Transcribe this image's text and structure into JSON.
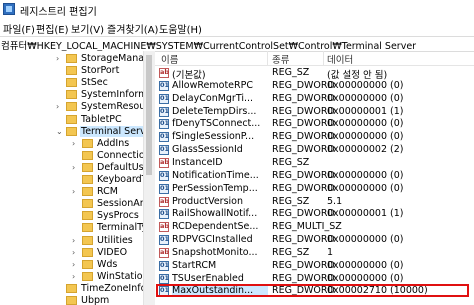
{
  "window": {
    "title": "레지스트리 편집기"
  },
  "menu": [
    "파일(F)",
    "편집(E)",
    "보기(V)",
    "즐겨찾기(A)",
    "도움말(H)"
  ],
  "address": "컴퓨터₩HKEY_LOCAL_MACHINE₩SYSTEM₩CurrentControlSet₩Control₩Terminal Server",
  "tree": [
    {
      "label": "StorageManage",
      "level": 0,
      "chevron": "›"
    },
    {
      "label": "StorPort",
      "level": 0,
      "chevron": ""
    },
    {
      "label": "StSec",
      "level": 0,
      "chevron": ""
    },
    {
      "label": "SystemInformat",
      "level": 0,
      "chevron": ""
    },
    {
      "label": "SystemResource",
      "level": 0,
      "chevron": "›"
    },
    {
      "label": "TabletPC",
      "level": 0,
      "chevron": ""
    },
    {
      "label": "Terminal Server",
      "level": 0,
      "chevron": "⌄",
      "selected": true
    },
    {
      "label": "AddIns",
      "level": 1,
      "chevron": "›"
    },
    {
      "label": "ConnectionH",
      "level": 1,
      "chevron": ""
    },
    {
      "label": "DefaultUserC",
      "level": 1,
      "chevron": "›"
    },
    {
      "label": "KeyboardTyp",
      "level": 1,
      "chevron": ""
    },
    {
      "label": "RCM",
      "level": 1,
      "chevron": "›"
    },
    {
      "label": "SessionArbit",
      "level": 1,
      "chevron": ""
    },
    {
      "label": "SysProcs",
      "level": 1,
      "chevron": ""
    },
    {
      "label": "TerminalTyp",
      "level": 1,
      "chevron": ""
    },
    {
      "label": "Utilities",
      "level": 1,
      "chevron": "›"
    },
    {
      "label": "VIDEO",
      "level": 1,
      "chevron": "›"
    },
    {
      "label": "Wds",
      "level": 1,
      "chevron": "›"
    },
    {
      "label": "WinStations",
      "level": 1,
      "chevron": "›"
    },
    {
      "label": "TimeZoneInfor",
      "level": 0,
      "chevron": ""
    },
    {
      "label": "Ubpm",
      "level": 0,
      "chevron": ""
    }
  ],
  "columns": {
    "name": "이름",
    "type": "종류",
    "data": "데이터"
  },
  "values": [
    {
      "name": "(기본값)",
      "type": "REG_SZ",
      "data": "(값 설정 안 됨)",
      "icon": "sz"
    },
    {
      "name": "AllowRemoteRPC",
      "type": "REG_DWORD",
      "data": "0x00000000 (0)",
      "icon": "dw"
    },
    {
      "name": "DelayConMgrTi...",
      "type": "REG_DWORD",
      "data": "0x00000000 (0)",
      "icon": "dw"
    },
    {
      "name": "DeleteTempDirs...",
      "type": "REG_DWORD",
      "data": "0x00000001 (1)",
      "icon": "dw"
    },
    {
      "name": "fDenyTSConnect...",
      "type": "REG_DWORD",
      "data": "0x00000000 (0)",
      "icon": "dw"
    },
    {
      "name": "fSingleSessionP...",
      "type": "REG_DWORD",
      "data": "0x00000000 (0)",
      "icon": "dw"
    },
    {
      "name": "GlassSessionId",
      "type": "REG_DWORD",
      "data": "0x00000002 (2)",
      "icon": "dw"
    },
    {
      "name": "InstanceID",
      "type": "REG_SZ",
      "data": "",
      "icon": "sz"
    },
    {
      "name": "NotificationTime...",
      "type": "REG_DWORD",
      "data": "0x00000000 (0)",
      "icon": "dw"
    },
    {
      "name": "PerSessionTemp...",
      "type": "REG_DWORD",
      "data": "0x00000000 (0)",
      "icon": "dw"
    },
    {
      "name": "ProductVersion",
      "type": "REG_SZ",
      "data": "5.1",
      "icon": "sz"
    },
    {
      "name": "RailShowallNotif...",
      "type": "REG_DWORD",
      "data": "0x00000001 (1)",
      "icon": "dw"
    },
    {
      "name": "RCDependentSe...",
      "type": "REG_MULTI_SZ",
      "data": "",
      "icon": "sz"
    },
    {
      "name": "RDPVGCInstalled",
      "type": "REG_DWORD",
      "data": "0x00000000 (0)",
      "icon": "dw"
    },
    {
      "name": "SnapshotMonito...",
      "type": "REG_SZ",
      "data": "1",
      "icon": "sz"
    },
    {
      "name": "StartRCM",
      "type": "REG_DWORD",
      "data": "0x00000000 (0)",
      "icon": "dw"
    },
    {
      "name": "TSUserEnabled",
      "type": "REG_DWORD",
      "data": "0x00000000 (0)",
      "icon": "dw"
    },
    {
      "name": "MaxOutstandin...",
      "type": "REG_DWORD",
      "data": "0x00002710 (10000)",
      "icon": "dw",
      "highlight": true
    }
  ]
}
